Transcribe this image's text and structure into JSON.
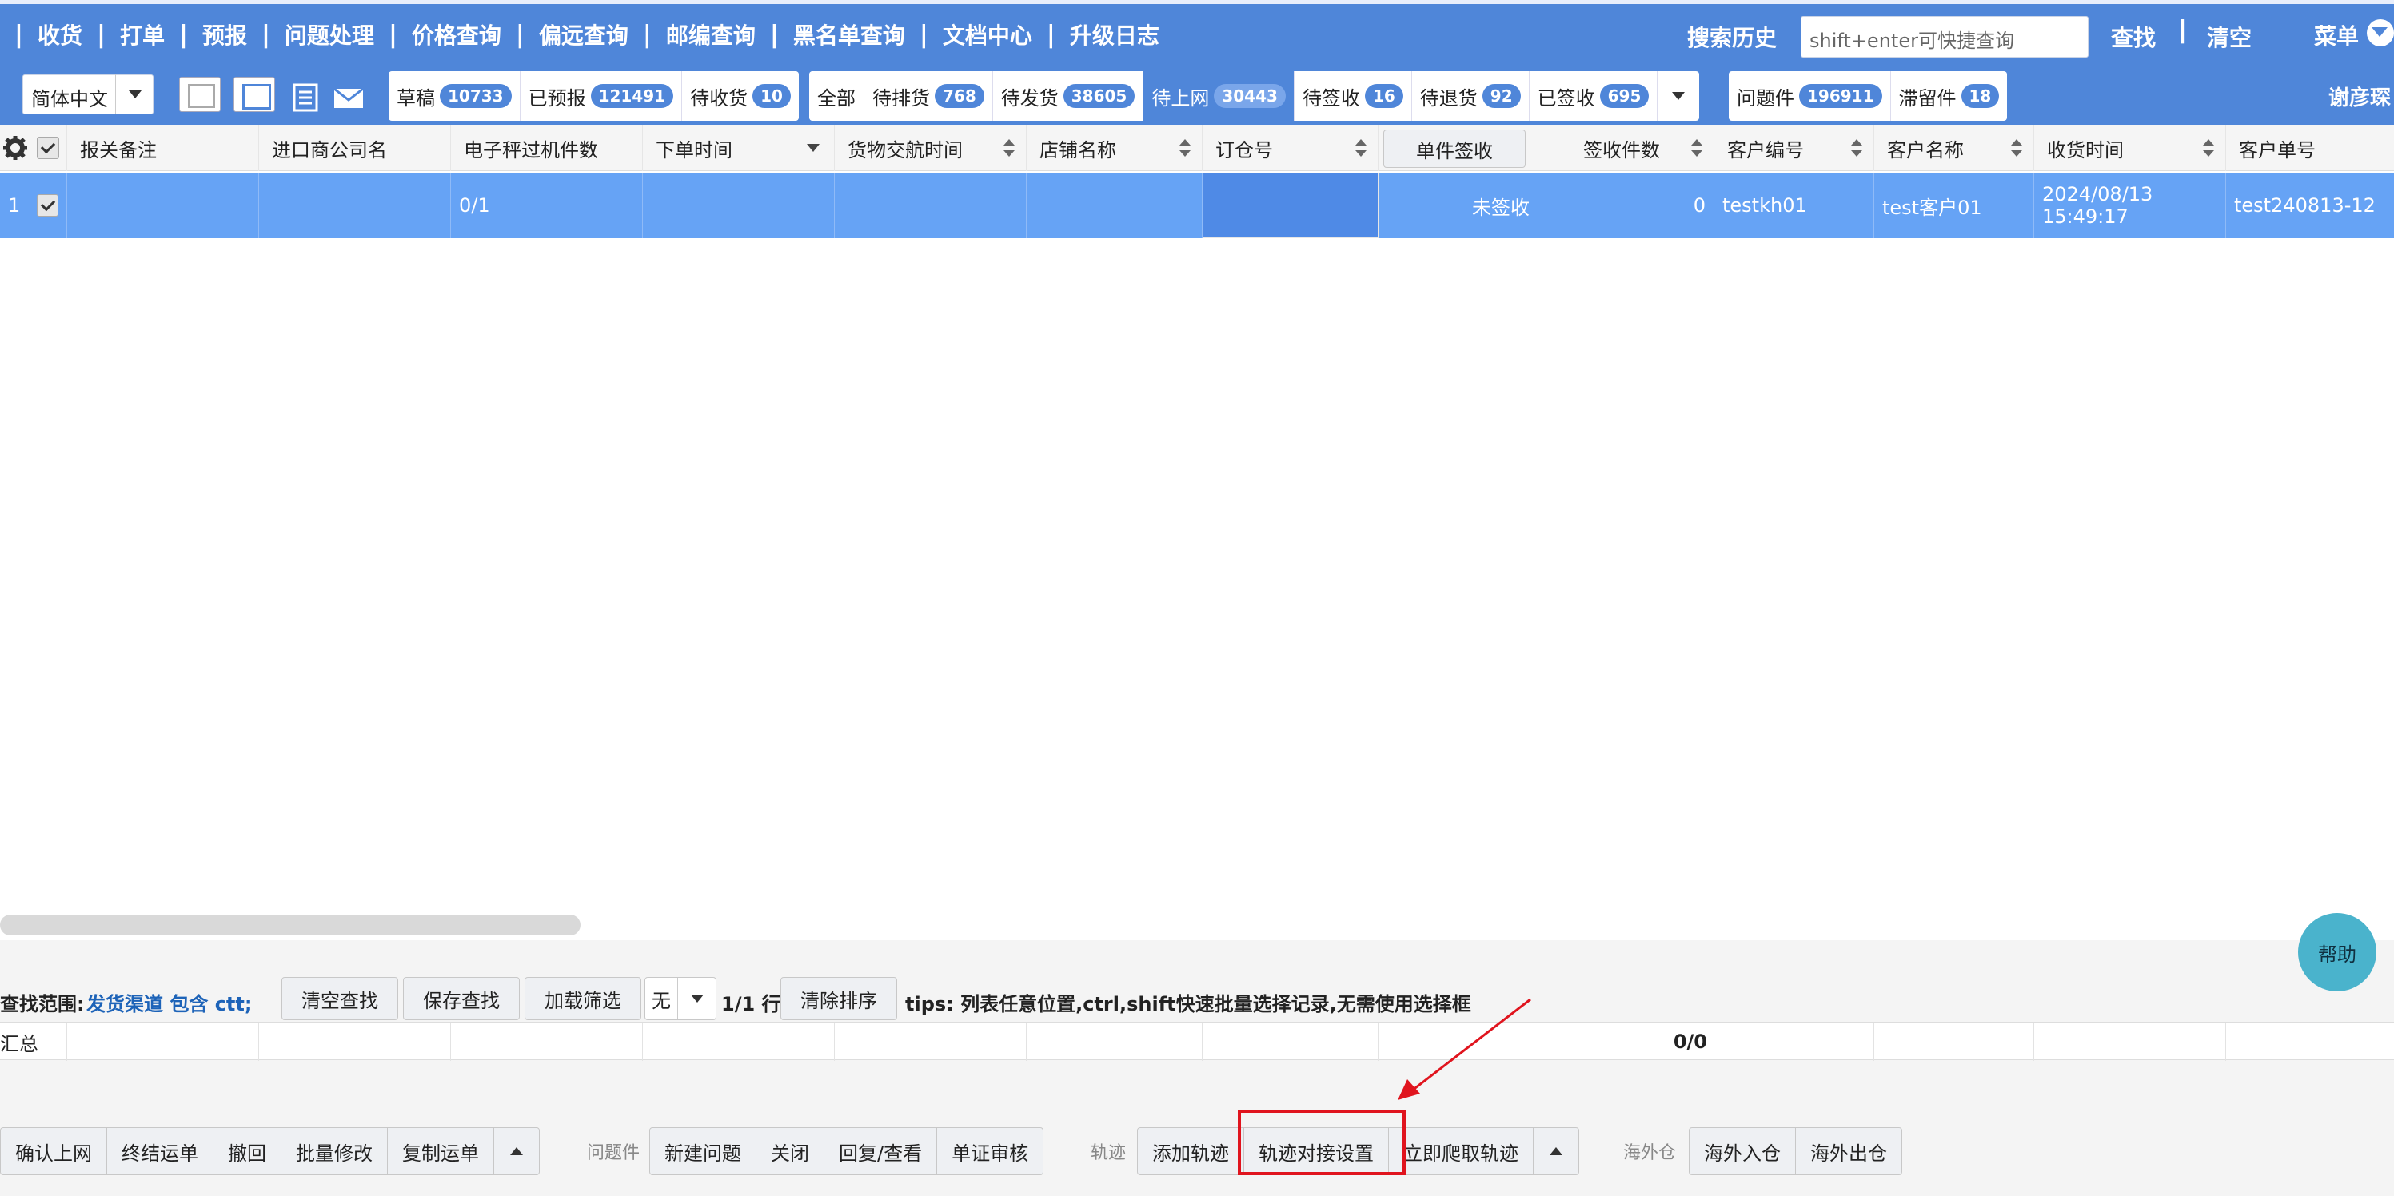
{
  "topnav": {
    "items": [
      "收货",
      "打单",
      "预报",
      "问题处理",
      "价格查询",
      "偏远查询",
      "邮编查询",
      "黑名单查询",
      "文档中心",
      "升级日志"
    ],
    "search_history": "搜索历史",
    "search_placeholder": "shift+enter可快捷查询",
    "find": "查找",
    "clear": "清空",
    "menu": "菜单"
  },
  "toolbar": {
    "language": "简体中文",
    "group1": [
      {
        "label": "草稿",
        "count": "10733"
      },
      {
        "label": "已预报",
        "count": "121491"
      },
      {
        "label": "待收货",
        "count": "10"
      }
    ],
    "group2": [
      {
        "label": "全部",
        "count": ""
      },
      {
        "label": "待排货",
        "count": "768"
      },
      {
        "label": "待发货",
        "count": "38605"
      },
      {
        "label": "待上网",
        "count": "30443"
      },
      {
        "label": "待签收",
        "count": "16"
      },
      {
        "label": "待退货",
        "count": "92"
      },
      {
        "label": "已签收",
        "count": "695"
      }
    ],
    "group3": [
      {
        "label": "问题件",
        "count": "196911"
      },
      {
        "label": "滞留件",
        "count": "18"
      }
    ],
    "active_tab": "待上网",
    "user_name": "谢彦琛"
  },
  "table": {
    "columns": [
      "报关备注",
      "进口商公司名",
      "电子秤过机件数",
      "下单时间",
      "货物交航时间",
      "店铺名称",
      "订仓号",
      "单件签收",
      "签收件数",
      "客户编号",
      "客户名称",
      "收货时间",
      "客户单号"
    ],
    "rows": [
      {
        "index": "1",
        "customs_note": "",
        "importer": "",
        "scale_count": "0/1",
        "order_time": "",
        "handover_time": "",
        "shop": "",
        "booking_no": "",
        "sign_status": "未签收",
        "sign_count": "0",
        "customer_code": "testkh01",
        "customer_name": "test客户01",
        "receive_time": "2024/08/13 15:49:17",
        "customer_order": "test240813-12"
      }
    ]
  },
  "filter_bar": {
    "scope_label": "查找范围:",
    "scope_value": "发货渠道 包含 ctt;",
    "clear_find": "清空查找",
    "save_find": "保存查找",
    "load_filter": "加载筛选",
    "filter_select": "无",
    "row_count": "1/1 行",
    "clear_sort": "清除排序",
    "tips": "tips: 列表任意位置,ctrl,shift快速批量选择记录,无需使用选择框"
  },
  "summary": {
    "label": "汇总",
    "sign_total": "0/0"
  },
  "help": "帮助",
  "actions": {
    "main": [
      "确认上网",
      "终结运单",
      "撤回",
      "批量修改",
      "复制运单"
    ],
    "problem_label": "问题件",
    "problem": [
      "新建问题",
      "关闭",
      "回复/查看",
      "单证审核"
    ],
    "track_label": "轨迹",
    "track": [
      "添加轨迹",
      "轨迹对接设置",
      "立即爬取轨迹"
    ],
    "overseas_label": "海外仓",
    "overseas": [
      "海外入仓",
      "海外出仓"
    ]
  },
  "annotation_color": "#e0141e",
  "accent_color": "#4f86d9"
}
